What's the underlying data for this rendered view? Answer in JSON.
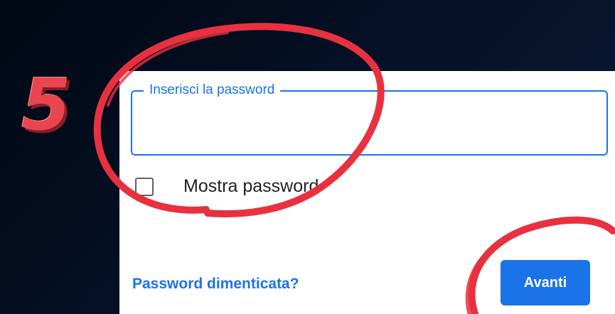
{
  "step": {
    "number": "5",
    "color": "#e8454f"
  },
  "form": {
    "password_label": "Inserisci la password",
    "password_value": "",
    "show_password_label": "Mostra password",
    "forgot_link": "Password dimenticata?",
    "next_button": "Avanti"
  },
  "colors": {
    "accent": "#1a73e8",
    "annotation": "#e8313f",
    "background": "#020a1c"
  },
  "annotations": [
    {
      "target": "password-field",
      "shape": "circle"
    },
    {
      "target": "next-button",
      "shape": "circle"
    }
  ]
}
